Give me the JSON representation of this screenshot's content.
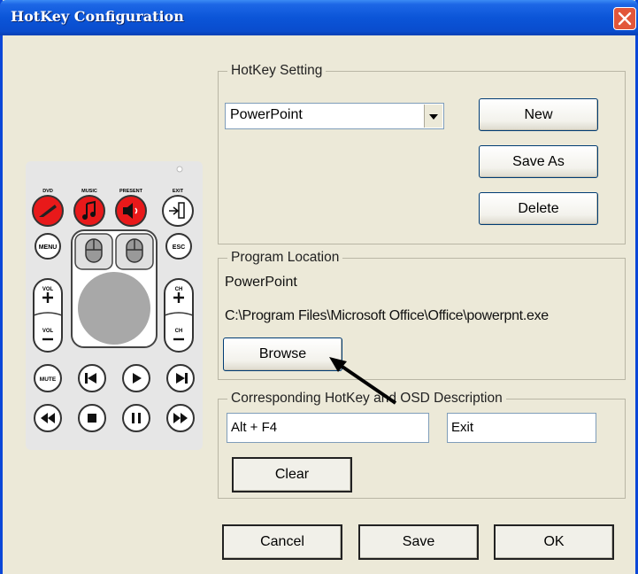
{
  "window": {
    "title": "HotKey Configuration"
  },
  "hotkey_setting": {
    "label": "HotKey Setting",
    "selected": "PowerPoint",
    "new_label": "New",
    "save_as_label": "Save As",
    "delete_label": "Delete"
  },
  "program_location": {
    "label": "Program Location",
    "name": "PowerPoint",
    "path": "C:\\Program Files\\Microsoft Office\\Office\\powerpnt.exe",
    "browse_label": "Browse"
  },
  "hotkey_osd": {
    "label": "Corresponding HotKey and OSD Description",
    "hotkey_value": "Alt + F4",
    "osd_value": "Exit",
    "clear_label": "Clear"
  },
  "footer": {
    "cancel_label": "Cancel",
    "save_label": "Save",
    "ok_label": "OK"
  },
  "remote": {
    "top_labels": [
      "DVD",
      "MUSIC",
      "PRESENT",
      "EXIT"
    ],
    "menu": "MENU",
    "esc": "ESC",
    "vol": "VOL",
    "ch": "CH",
    "mute": "MUTE",
    "accent_color": "#e8191a"
  }
}
